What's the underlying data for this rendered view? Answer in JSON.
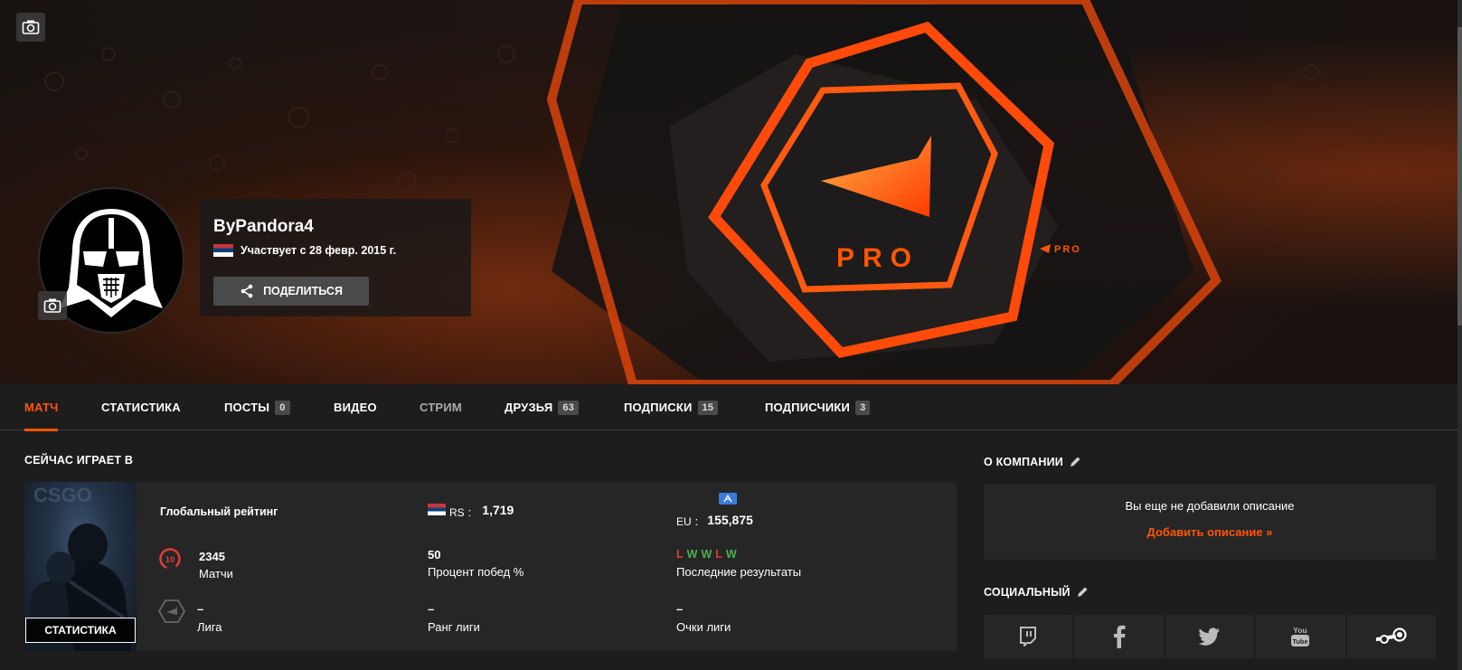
{
  "profile": {
    "username": "ByPandora4",
    "since": "Участвует с 28 февр. 2015 г.",
    "share_label": "ПОДЕЛИТЬСЯ",
    "banner_text": "PRO",
    "banner_small_text": "PRO"
  },
  "tabs": [
    {
      "label": "МАТЧ"
    },
    {
      "label": "СТАТИСТИКА"
    },
    {
      "label": "ПОСТЫ",
      "count": "0"
    },
    {
      "label": "ВИДЕО"
    },
    {
      "label": "СТРИМ"
    },
    {
      "label": "ДРУЗЬЯ",
      "count": "63"
    },
    {
      "label": "ПОДПИСКИ",
      "count": "15"
    },
    {
      "label": "ПОДПИСЧИКИ",
      "count": "3"
    }
  ],
  "now_playing": {
    "title": "СЕЙЧАС ИГРАЕТ В",
    "cover_stats_label": "СТАТИСТИКА",
    "global_rank_label": "Глобальный рейтинг",
    "country_code": "RS",
    "country_rank": "1,719",
    "region_code": "EU",
    "region_rank": "155,875",
    "level": "10",
    "matches_value": "2345",
    "matches_label": "Матчи",
    "winrate_value": "50",
    "winrate_label": "Процент побед %",
    "recent_results": [
      "L",
      "W",
      "W",
      "L",
      "W"
    ],
    "recent_label": "Последние результаты",
    "league_value": "–",
    "league_label": "Лига",
    "league_rank_value": "–",
    "league_rank_label": "Ранг лиги",
    "league_points_value": "–",
    "league_points_label": "Очки лиги"
  },
  "about": {
    "title": "О КОМПАНИИ",
    "empty_text": "Вы еще не добавили описание",
    "add_label": "Добавить описание »"
  },
  "social": {
    "title": "СОЦИАЛЬНЫЙ",
    "items": [
      "twitch-icon",
      "facebook-icon",
      "twitter-icon",
      "youtube-icon",
      "steam-icon"
    ]
  },
  "colors": {
    "accent": "#ff5500",
    "win": "#4caf50",
    "loss": "#e53935"
  }
}
